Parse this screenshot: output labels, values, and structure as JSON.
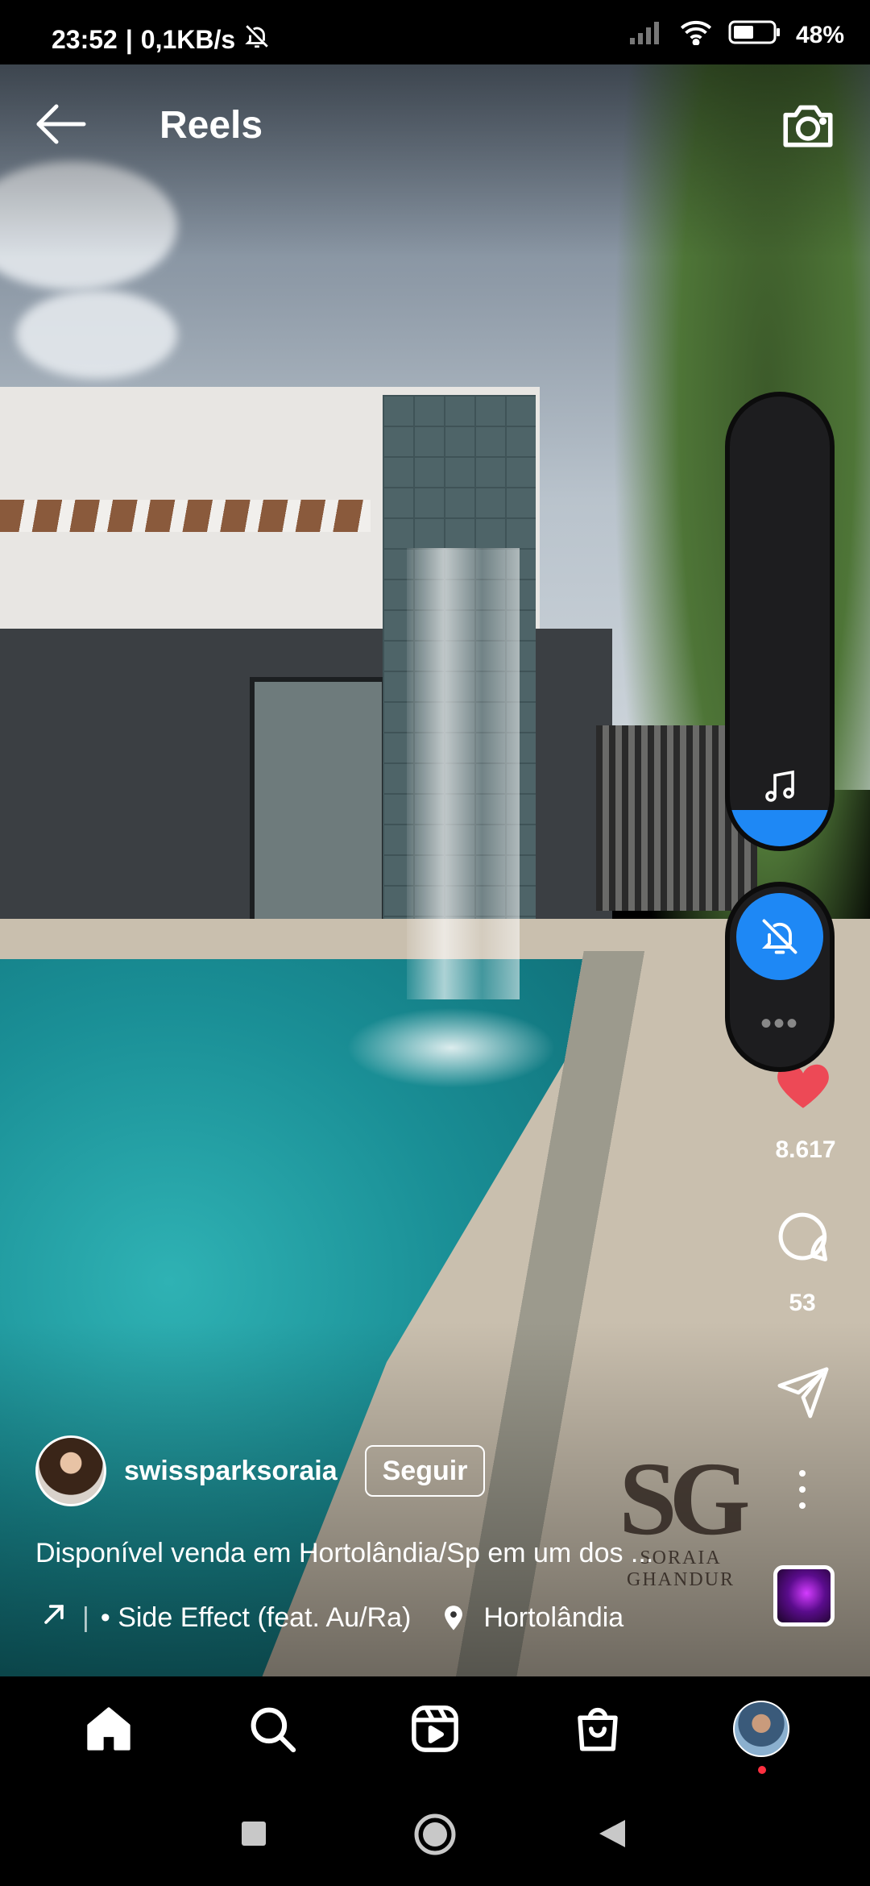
{
  "status_bar": {
    "time": "23:52",
    "network_speed": "0,1KB/s",
    "battery": "48%",
    "icons": [
      "bell-off-icon",
      "signal-icon",
      "wifi-icon",
      "battery-icon"
    ]
  },
  "header": {
    "title": "Reels",
    "back_icon": "arrow-left-icon",
    "camera_icon": "camera-icon"
  },
  "volume_panel": {
    "level_percent": 8,
    "accent_color": "#1e88f5",
    "music_icon": "music-note-icon",
    "mute_icon": "bell-off-icon",
    "more_icon": "more-horizontal-icon"
  },
  "actions": {
    "likes": "8.617",
    "comments": "53",
    "like_color": "#ed4956"
  },
  "watermark": {
    "mark": "SG",
    "text": "SORAIA GHANDUR"
  },
  "author": {
    "username": "swissparksoraia",
    "follow_label": "Seguir"
  },
  "caption": "Disponível venda em Hortolândia/Sp em um dos ...",
  "audio": {
    "track": "• Side Effect (feat. Au/Ra)"
  },
  "location": {
    "name": "Hortolândia"
  },
  "bottom_nav": {
    "items": [
      "home-icon",
      "search-icon",
      "reels-icon",
      "shop-icon",
      "profile-avatar"
    ]
  }
}
